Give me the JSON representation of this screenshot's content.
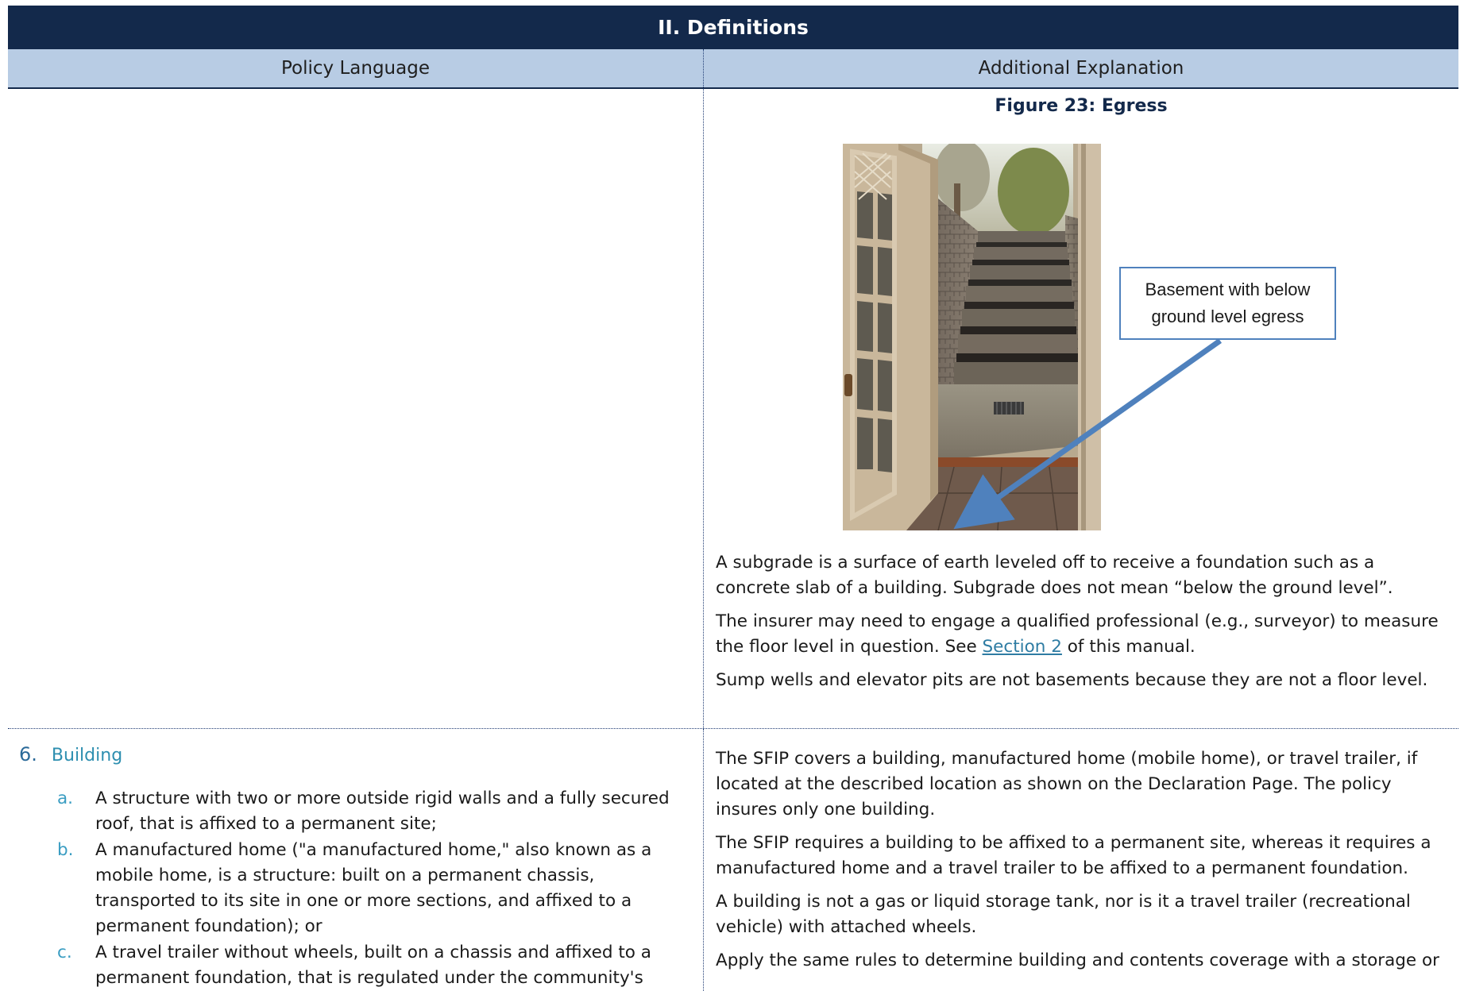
{
  "header": {
    "title": "II. Definitions",
    "col_left": "Policy Language",
    "col_right": "Additional Explanation"
  },
  "figure": {
    "caption": "Figure 23: Egress",
    "callout_line1": "Basement with below",
    "callout_line2": "ground level egress"
  },
  "explanation": {
    "p1": "A subgrade is a surface of earth leveled off to receive a foundation such as a concrete slab of a building. Subgrade does not mean “below the ground level”.",
    "p2_before": "The insurer may need to engage a qualified professional (e.g., surveyor) to measure the floor level in question. See ",
    "p2_link": "Section 2",
    "p2_after": " of this manual.",
    "p3": "Sump wells and elevator pits are not basements because they are not a floor level."
  },
  "definition": {
    "number": "6.",
    "term": "Building",
    "items": [
      {
        "marker": "a.",
        "text": "A structure with two or more outside rigid walls and a fully secured roof, that is affixed to a permanent site;"
      },
      {
        "marker": "b.",
        "text": "A manufactured home (\"a manufactured home,\" also known as a mobile home, is a structure: built on a permanent chassis, transported to its site in one or more sections, and affixed to a permanent foundation); or"
      },
      {
        "marker": "c.",
        "text": "A travel trailer without wheels, built on a chassis and affixed to a permanent foundation, that is regulated under the community's"
      }
    ]
  },
  "building_explanation": {
    "p1": "The SFIP covers a building, manufactured home (mobile home), or travel trailer, if located at the described location as shown on the Declaration Page. The policy insures only one building.",
    "p2": "The SFIP requires a building to be affixed to a permanent site, whereas it requires a manufactured home and a travel trailer to be affixed to a permanent foundation.",
    "p3": "A building is not a gas or liquid storage tank, nor is it a travel trailer (recreational vehicle) with attached wheels.",
    "p4": "Apply the same rules to determine building and contents coverage with a storage or"
  }
}
